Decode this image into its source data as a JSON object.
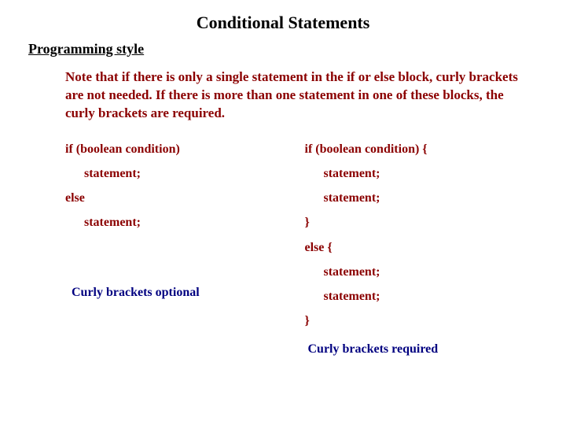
{
  "title": "Conditional Statements",
  "subhead": "Programming style",
  "para": "Note that if there is only a single statement in the if or else block, curly brackets are not needed.  If there is more than one statement in one of these blocks, the curly brackets are required.",
  "left": {
    "l1": "if (boolean condition)",
    "l2": "statement;",
    "l3": "else",
    "l4": "statement;",
    "caption": "Curly brackets optional"
  },
  "right": {
    "l1": "if (boolean condition) {",
    "l2": "statement;",
    "l3": "statement;",
    "l4": "}",
    "l5": "else {",
    "l6": "statement;",
    "l7": "statement;",
    "l8": "}",
    "caption": "Curly brackets required"
  }
}
